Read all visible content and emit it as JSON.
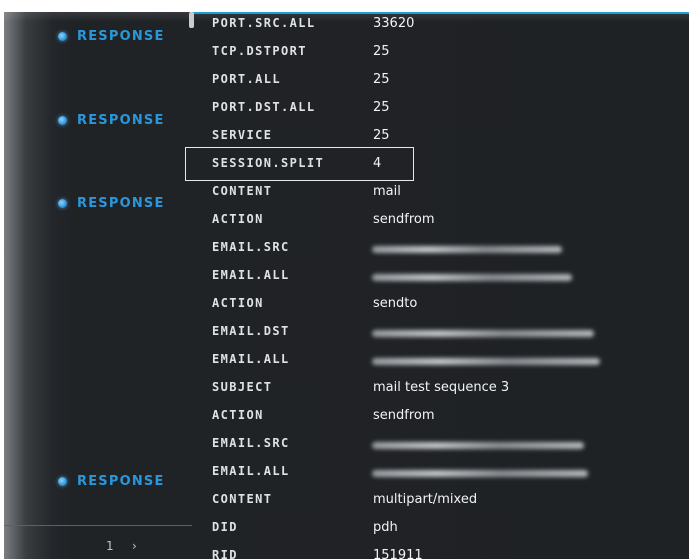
{
  "responses": [
    "RESPONSE",
    "RESPONSE",
    "RESPONSE",
    "RESPONSE"
  ],
  "rows": [
    {
      "key": "PORT.SRC.ALL",
      "value": "33620"
    },
    {
      "key": "TCP.DSTPORT",
      "value": "25"
    },
    {
      "key": "PORT.ALL",
      "value": "25"
    },
    {
      "key": "PORT.DST.ALL",
      "value": "25"
    },
    {
      "key": "SERVICE",
      "value": "25"
    },
    {
      "key": "SESSION.SPLIT",
      "value": "4"
    },
    {
      "key": "CONTENT",
      "value": "mail"
    },
    {
      "key": "ACTION",
      "value": "sendfrom"
    },
    {
      "key": "EMAIL.SRC",
      "value": ""
    },
    {
      "key": "EMAIL.ALL",
      "value": ""
    },
    {
      "key": "ACTION",
      "value": "sendto"
    },
    {
      "key": "EMAIL.DST",
      "value": ""
    },
    {
      "key": "EMAIL.ALL",
      "value": ""
    },
    {
      "key": "SUBJECT",
      "value": "mail test sequence 3"
    },
    {
      "key": "ACTION",
      "value": "sendfrom"
    },
    {
      "key": "EMAIL.SRC",
      "value": ""
    },
    {
      "key": "EMAIL.ALL",
      "value": ""
    },
    {
      "key": "CONTENT",
      "value": "multipart/mixed"
    },
    {
      "key": "DID",
      "value": "pdh"
    },
    {
      "key": "RID",
      "value": "151911"
    }
  ],
  "pagination": {
    "page": "1",
    "next": "›"
  },
  "colors": {
    "accent": "#2a97dc",
    "highlight_border": "#e8e8e8"
  }
}
